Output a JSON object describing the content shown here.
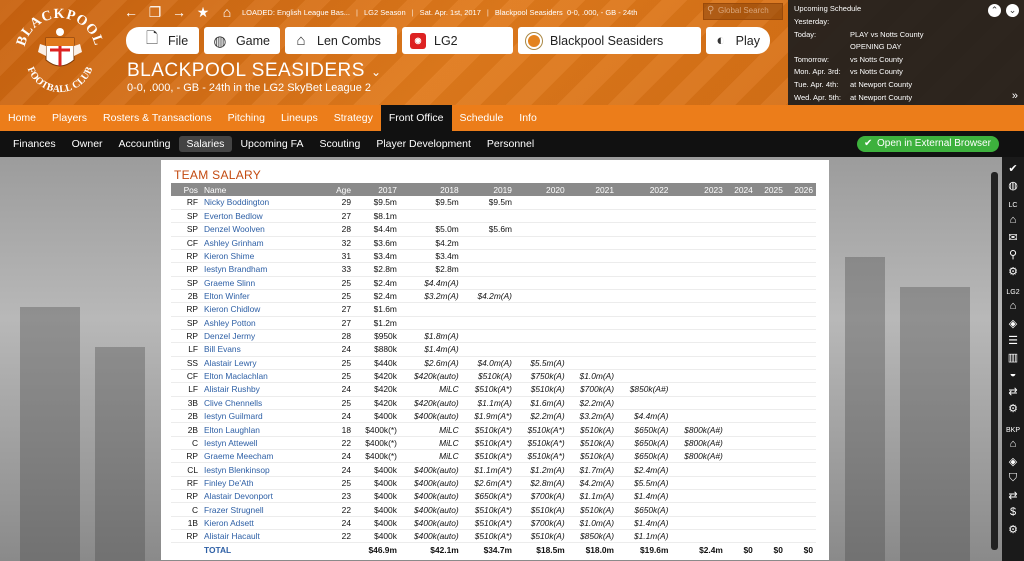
{
  "header": {
    "loaded": "LOADED: English League Bas...",
    "season": "LG2 Season",
    "date": "Sat. Apr. 1st, 2017",
    "team_record": "Blackpool Seasiders  0-0, .000, - GB - 24th",
    "search_placeholder": "Global Search",
    "tabs": {
      "file": "File",
      "game": "Game",
      "manager": "Len Combs",
      "league": "LG2",
      "team": "Blackpool Seasiders",
      "play": "Play"
    },
    "team_name": "BLACKPOOL SEASIDERS",
    "team_subtitle": "0-0, .000, - GB - 24th in the LG2 SkyBet League 2",
    "logo_text_top": "BLACKPOOL",
    "logo_text_bottom": "FOOTBALL CLUB"
  },
  "schedule": {
    "title": "Upcoming Schedule",
    "rows": [
      {
        "day": "Yesterday:",
        "value": ""
      },
      {
        "day": "Today:",
        "value": "PLAY vs Notts County"
      },
      {
        "day": "",
        "value": "OPENING DAY"
      },
      {
        "day": "Tomorrow:",
        "value": "vs Notts County"
      },
      {
        "day": "Mon. Apr. 3rd:",
        "value": "vs Notts County"
      },
      {
        "day": "Tue. Apr. 4th:",
        "value": "at Newport County"
      },
      {
        "day": "Wed. Apr. 5th:",
        "value": "at Newport County"
      }
    ]
  },
  "menu": [
    "Home",
    "Players",
    "Rosters & Transactions",
    "Pitching",
    "Lineups",
    "Strategy",
    "Front Office",
    "Schedule",
    "Info"
  ],
  "menu_active": "Front Office",
  "submenu": [
    "Finances",
    "Owner",
    "Accounting",
    "Salaries",
    "Upcoming FA",
    "Scouting",
    "Player Development",
    "Personnel"
  ],
  "submenu_active": "Salaries",
  "external_button": "Open in External Browser",
  "sidebar_labels": {
    "lc": "LC",
    "lg2": "LG2",
    "bkp": "BKP"
  },
  "salary": {
    "title": "TEAM SALARY",
    "columns": [
      "Pos",
      "Name",
      "Age",
      "2017",
      "2018",
      "2019",
      "2020",
      "2021",
      "2022",
      "2023",
      "2024",
      "2025",
      "2026"
    ],
    "rows": [
      [
        "RF",
        "Nicky Boddington",
        "29",
        "$9.5m",
        "$9.5m",
        "$9.5m",
        "",
        "",
        "",
        "",
        "",
        "",
        ""
      ],
      [
        "SP",
        "Everton Bedlow",
        "27",
        "$8.1m",
        "",
        "",
        "",
        "",
        "",
        "",
        "",
        "",
        ""
      ],
      [
        "SP",
        "Denzel Woolven",
        "28",
        "$4.4m",
        "$5.0m",
        "$5.6m",
        "",
        "",
        "",
        "",
        "",
        "",
        ""
      ],
      [
        "CF",
        "Ashley Grinham",
        "32",
        "$3.6m",
        "$4.2m",
        "",
        "",
        "",
        "",
        "",
        "",
        "",
        ""
      ],
      [
        "RP",
        "Kieron Shime",
        "31",
        "$3.4m",
        "$3.4m",
        "",
        "",
        "",
        "",
        "",
        "",
        "",
        ""
      ],
      [
        "RP",
        "Iestyn Brandham",
        "33",
        "$2.8m",
        "$2.8m",
        "",
        "",
        "",
        "",
        "",
        "",
        "",
        ""
      ],
      [
        "SP",
        "Graeme Slinn",
        "25",
        "$2.4m",
        "$4.4m(A)",
        "",
        "",
        "",
        "",
        "",
        "",
        "",
        ""
      ],
      [
        "2B",
        "Elton Winfer",
        "25",
        "$2.4m",
        "$3.2m(A)",
        "$4.2m(A)",
        "",
        "",
        "",
        "",
        "",
        "",
        ""
      ],
      [
        "RP",
        "Kieron Chidlow",
        "27",
        "$1.6m",
        "",
        "",
        "",
        "",
        "",
        "",
        "",
        "",
        ""
      ],
      [
        "SP",
        "Ashley Potton",
        "27",
        "$1.2m",
        "",
        "",
        "",
        "",
        "",
        "",
        "",
        "",
        ""
      ],
      [
        "RP",
        "Denzel Jermy",
        "28",
        "$950k",
        "$1.8m(A)",
        "",
        "",
        "",
        "",
        "",
        "",
        "",
        ""
      ],
      [
        "LF",
        "Bill Evans",
        "24",
        "$880k",
        "$1.4m(A)",
        "",
        "",
        "",
        "",
        "",
        "",
        "",
        ""
      ],
      [
        "SS",
        "Alastair Lewry",
        "25",
        "$440k",
        "$2.6m(A)",
        "$4.0m(A)",
        "$5.5m(A)",
        "",
        "",
        "",
        "",
        "",
        ""
      ],
      [
        "CF",
        "Elton Maclachlan",
        "25",
        "$420k",
        "$420k(auto)",
        "$510k(A)",
        "$750k(A)",
        "$1.0m(A)",
        "",
        "",
        "",
        "",
        ""
      ],
      [
        "LF",
        "Alistair Rushby",
        "24",
        "$420k",
        "MiLC",
        "$510k(A*)",
        "$510k(A)",
        "$700k(A)",
        "$850k(A#)",
        "",
        "",
        "",
        ""
      ],
      [
        "3B",
        "Clive Chennells",
        "25",
        "$420k",
        "$420k(auto)",
        "$1.1m(A)",
        "$1.6m(A)",
        "$2.2m(A)",
        "",
        "",
        "",
        "",
        ""
      ],
      [
        "2B",
        "Iestyn Guilmard",
        "24",
        "$400k",
        "$400k(auto)",
        "$1.9m(A*)",
        "$2.2m(A)",
        "$3.2m(A)",
        "$4.4m(A)",
        "",
        "",
        "",
        ""
      ],
      [
        "2B",
        "Elton Laughlan",
        "18",
        "$400k(*)",
        "MiLC",
        "$510k(A*)",
        "$510k(A*)",
        "$510k(A)",
        "$650k(A)",
        "$800k(A#)",
        "",
        "",
        ""
      ],
      [
        "C",
        "Iestyn Attewell",
        "22",
        "$400k(*)",
        "MiLC",
        "$510k(A*)",
        "$510k(A*)",
        "$510k(A)",
        "$650k(A)",
        "$800k(A#)",
        "",
        "",
        ""
      ],
      [
        "RP",
        "Graeme Meecham",
        "24",
        "$400k(*)",
        "MiLC",
        "$510k(A*)",
        "$510k(A*)",
        "$510k(A)",
        "$650k(A)",
        "$800k(A#)",
        "",
        "",
        ""
      ],
      [
        "CL",
        "Iestyn Blenkinsop",
        "24",
        "$400k",
        "$400k(auto)",
        "$1.1m(A*)",
        "$1.2m(A)",
        "$1.7m(A)",
        "$2.4m(A)",
        "",
        "",
        "",
        ""
      ],
      [
        "RF",
        "Finley De'Ath",
        "25",
        "$400k",
        "$400k(auto)",
        "$2.6m(A*)",
        "$2.8m(A)",
        "$4.2m(A)",
        "$5.5m(A)",
        "",
        "",
        "",
        ""
      ],
      [
        "RP",
        "Alastair Devonport",
        "23",
        "$400k",
        "$400k(auto)",
        "$650k(A*)",
        "$700k(A)",
        "$1.1m(A)",
        "$1.4m(A)",
        "",
        "",
        "",
        ""
      ],
      [
        "C",
        "Frazer Strugnell",
        "22",
        "$400k",
        "$400k(auto)",
        "$510k(A*)",
        "$510k(A)",
        "$510k(A)",
        "$650k(A)",
        "",
        "",
        "",
        ""
      ],
      [
        "1B",
        "Kieron Adsett",
        "24",
        "$400k",
        "$400k(auto)",
        "$510k(A*)",
        "$700k(A)",
        "$1.0m(A)",
        "$1.4m(A)",
        "",
        "",
        "",
        ""
      ],
      [
        "RP",
        "Alistair Hacault",
        "22",
        "$400k",
        "$400k(auto)",
        "$510k(A*)",
        "$510k(A)",
        "$850k(A)",
        "$1.1m(A)",
        "",
        "",
        "",
        ""
      ]
    ],
    "total": [
      "",
      "TOTAL",
      "",
      "$46.9m",
      "$42.1m",
      "$34.7m",
      "$18.5m",
      "$18.0m",
      "$19.6m",
      "$2.4m",
      "$0",
      "$0",
      "$0"
    ]
  },
  "colors": {
    "orange": "#ec7d1a",
    "header_orange": "#d06a12",
    "title_orange": "#c34a10",
    "link_blue": "#2d5fa5",
    "green": "#3db13d"
  }
}
